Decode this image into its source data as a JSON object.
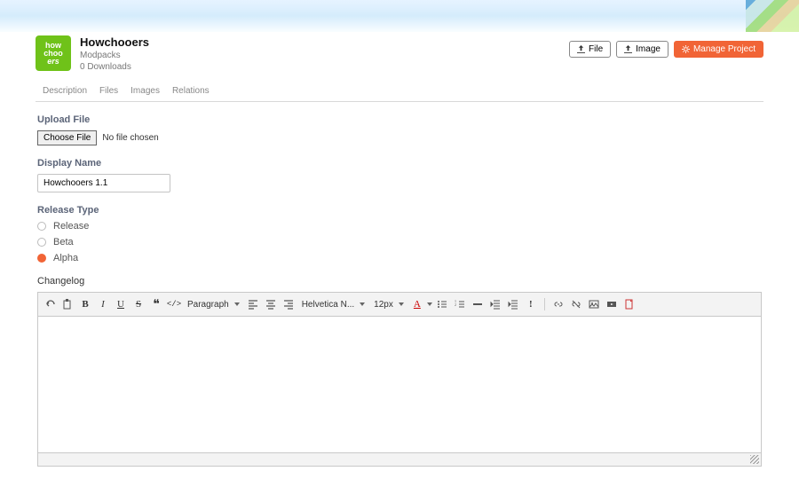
{
  "header": {
    "avatar_line1": "how",
    "avatar_line2": "choo",
    "avatar_line3": "ers",
    "title": "Howchooers",
    "subtitle": "Modpacks",
    "downloads": "0 Downloads"
  },
  "actions": {
    "file": "File",
    "image": "Image",
    "manage": "Manage Project"
  },
  "tabs": [
    "Description",
    "Files",
    "Images",
    "Relations"
  ],
  "form": {
    "upload_label": "Upload File",
    "choose_label": "Choose File",
    "nofile": "No file chosen",
    "display_name_label": "Display Name",
    "display_name_value": "Howchooers 1.1",
    "release_type_label": "Release Type",
    "release_options": [
      "Release",
      "Beta",
      "Alpha"
    ],
    "release_selected": "Alpha",
    "changelog_label": "Changelog"
  },
  "editor": {
    "paragraph": "Paragraph",
    "font": "Helvetica N...",
    "size": "12px"
  }
}
